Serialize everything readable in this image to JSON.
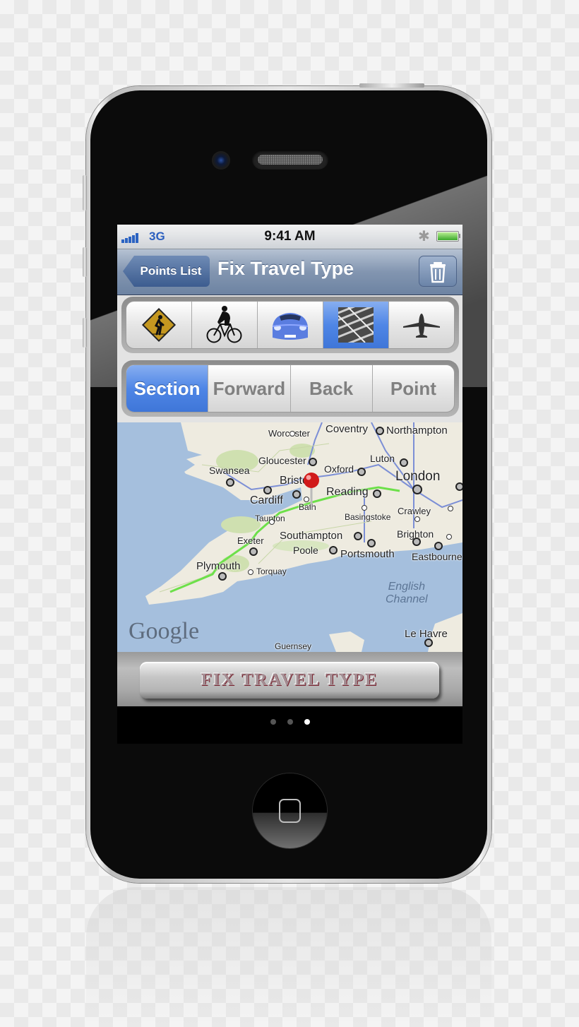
{
  "status_bar": {
    "network": "3G",
    "time": "9:41 AM",
    "signal_bars": 5,
    "bluetooth_icon": "bluetooth-icon",
    "battery_icon": "battery-icon"
  },
  "nav_bar": {
    "back_label": "Points List",
    "title": "Fix Travel Type",
    "trash_icon": "trash-icon"
  },
  "travel_types": [
    {
      "name": "walk",
      "icon": "pedestrian-sign-icon",
      "selected": false
    },
    {
      "name": "cycle",
      "icon": "cyclist-icon",
      "selected": false
    },
    {
      "name": "car",
      "icon": "car-icon",
      "selected": false
    },
    {
      "name": "rail",
      "icon": "rail-track-icon",
      "selected": true
    },
    {
      "name": "plane",
      "icon": "airplane-icon",
      "selected": false
    }
  ],
  "scope_tabs": [
    {
      "label": "Section",
      "selected": true
    },
    {
      "label": "Forward",
      "selected": false
    },
    {
      "label": "Back",
      "selected": false
    },
    {
      "label": "Point",
      "selected": false
    }
  ],
  "map": {
    "logo": "Google",
    "sea_label_1": "English",
    "sea_label_2": "Channel",
    "cities": [
      "Worcester",
      "Coventry",
      "Northampton",
      "Gloucester",
      "Luton",
      "Swansea",
      "Oxford",
      "London",
      "Bristol",
      "Reading",
      "Cardiff",
      "Bath",
      "Crawley",
      "Taunton",
      "Basingstoke",
      "Brighton",
      "Exeter",
      "Southampton",
      "Poole",
      "Portsmouth",
      "Eastbourne",
      "Plymouth",
      "Torquay",
      "Guernsey",
      "Le Havre"
    ]
  },
  "action_button": {
    "label": "FIX TRAVEL TYPE"
  },
  "page_indicator": {
    "count": 3,
    "current": 3
  },
  "colors": {
    "accent_blue": "#4f86e6",
    "nav_bar": "#8295b0",
    "route_green": "#6de04a",
    "map_sea": "#a5bfdd",
    "pin_red": "#d11a1a"
  }
}
